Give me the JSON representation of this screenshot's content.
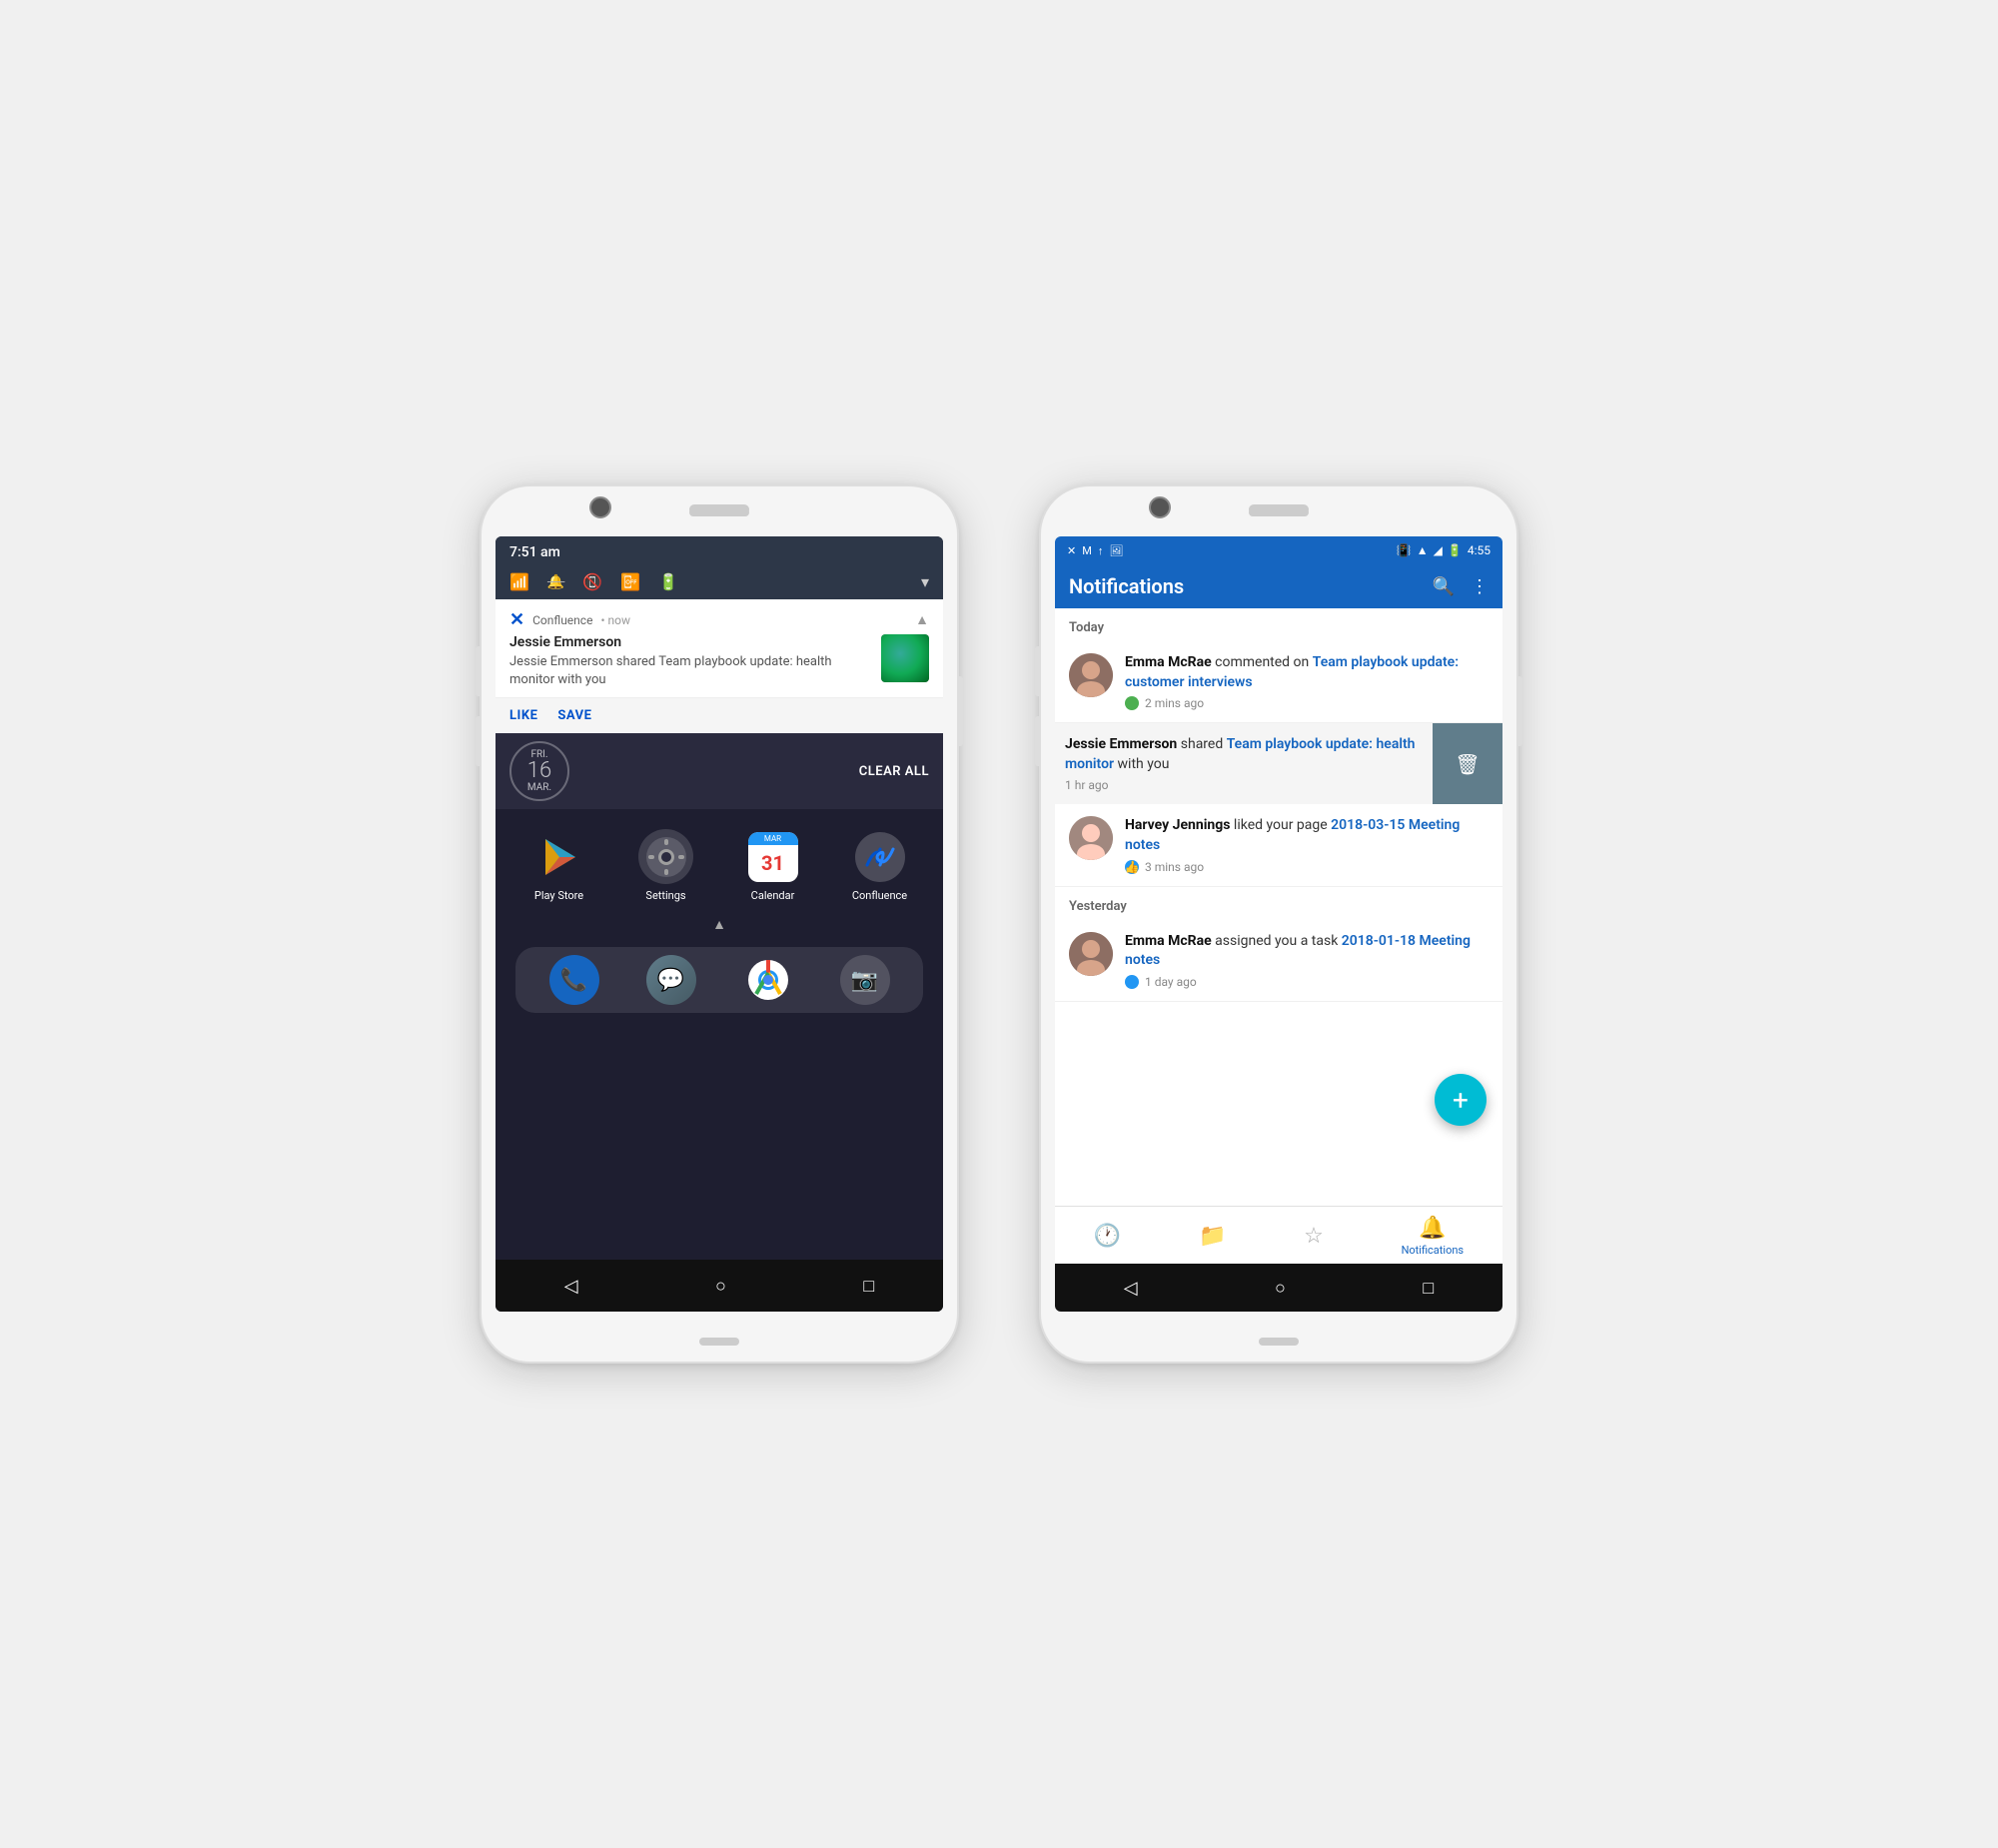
{
  "phone1": {
    "status_bar": {
      "time": "7:51 am"
    },
    "notification": {
      "app_name": "Confluence",
      "time": "now",
      "sender": "Jessie Emmerson",
      "description": "Jessie Emmerson shared Team playbook update: health monitor with you",
      "action1": "LIKE",
      "action2": "SAVE"
    },
    "date_display": {
      "day": "FRI.",
      "num": "16",
      "month": "MAR."
    },
    "clear_all": "CLEAR ALL",
    "apps": [
      {
        "label": "Play Store"
      },
      {
        "label": "Settings"
      },
      {
        "label": "Calendar"
      },
      {
        "label": "Confluence"
      }
    ],
    "nav": {
      "back": "◁",
      "home": "○",
      "recents": "□"
    }
  },
  "phone2": {
    "status_bar": {
      "time": "4:55"
    },
    "toolbar": {
      "title": "Notifications",
      "search_label": "search",
      "menu_label": "more options"
    },
    "sections": [
      {
        "header": "Today",
        "items": [
          {
            "user": "Emma McRae",
            "action": "commented on",
            "target": "Team playbook update: customer interviews",
            "time": "2 mins ago",
            "dot_color": "green"
          },
          {
            "user": "Jessie Emmerson",
            "action": "shared",
            "target": "Team playbook update: health monitor",
            "suffix": "with you",
            "time": "1 hr ago",
            "swiped": true,
            "dot_color": "none"
          },
          {
            "user": "Harvey Jennings",
            "action": "liked your page",
            "target": "2018-03-15 Meeting notes",
            "time": "3 mins ago",
            "dot_color": "blue"
          }
        ]
      },
      {
        "header": "Yesterday",
        "items": [
          {
            "user": "Emma McRae",
            "action": "assigned you a task",
            "target": "2018-01-18 Meeting notes",
            "time": "1 day ago",
            "dot_color": "blue"
          }
        ]
      }
    ],
    "fab_label": "+",
    "bottom_nav": [
      {
        "label": "Recent",
        "icon": "🕐",
        "active": false
      },
      {
        "label": "Spaces",
        "icon": "📁",
        "active": false
      },
      {
        "label": "Starred",
        "icon": "☆",
        "active": false
      },
      {
        "label": "Notifications",
        "icon": "🔔",
        "active": true
      }
    ],
    "nav": {
      "back": "◁",
      "home": "○",
      "recents": "□"
    }
  }
}
